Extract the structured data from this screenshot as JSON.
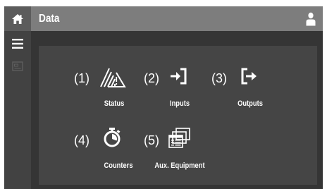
{
  "header": {
    "title": "Data",
    "home_icon": "home-icon",
    "user_icon": "user-icon"
  },
  "sidebar": {
    "menu_icon": "hamburger-menu-icon",
    "aux_icon": "screen-icon"
  },
  "tiles": [
    {
      "number": "(1)",
      "label": "Status",
      "icon": "status-signal-icon"
    },
    {
      "number": "(2)",
      "label": "Inputs",
      "icon": "input-arrow-icon"
    },
    {
      "number": "(3)",
      "label": "Outputs",
      "icon": "output-arrow-icon"
    },
    {
      "number": "(4)",
      "label": "Counters",
      "icon": "stopwatch-icon"
    },
    {
      "number": "(5)",
      "label": "Aux. Equipment",
      "icon": "stacked-windows-icon"
    }
  ],
  "colors": {
    "header_bg": "#7d7d7d",
    "home_bg": "#5c5c5c",
    "frame_bg": "#353535",
    "sidebar_bg": "#424242",
    "panel_bg": "#454545",
    "text": "#ffffff"
  }
}
